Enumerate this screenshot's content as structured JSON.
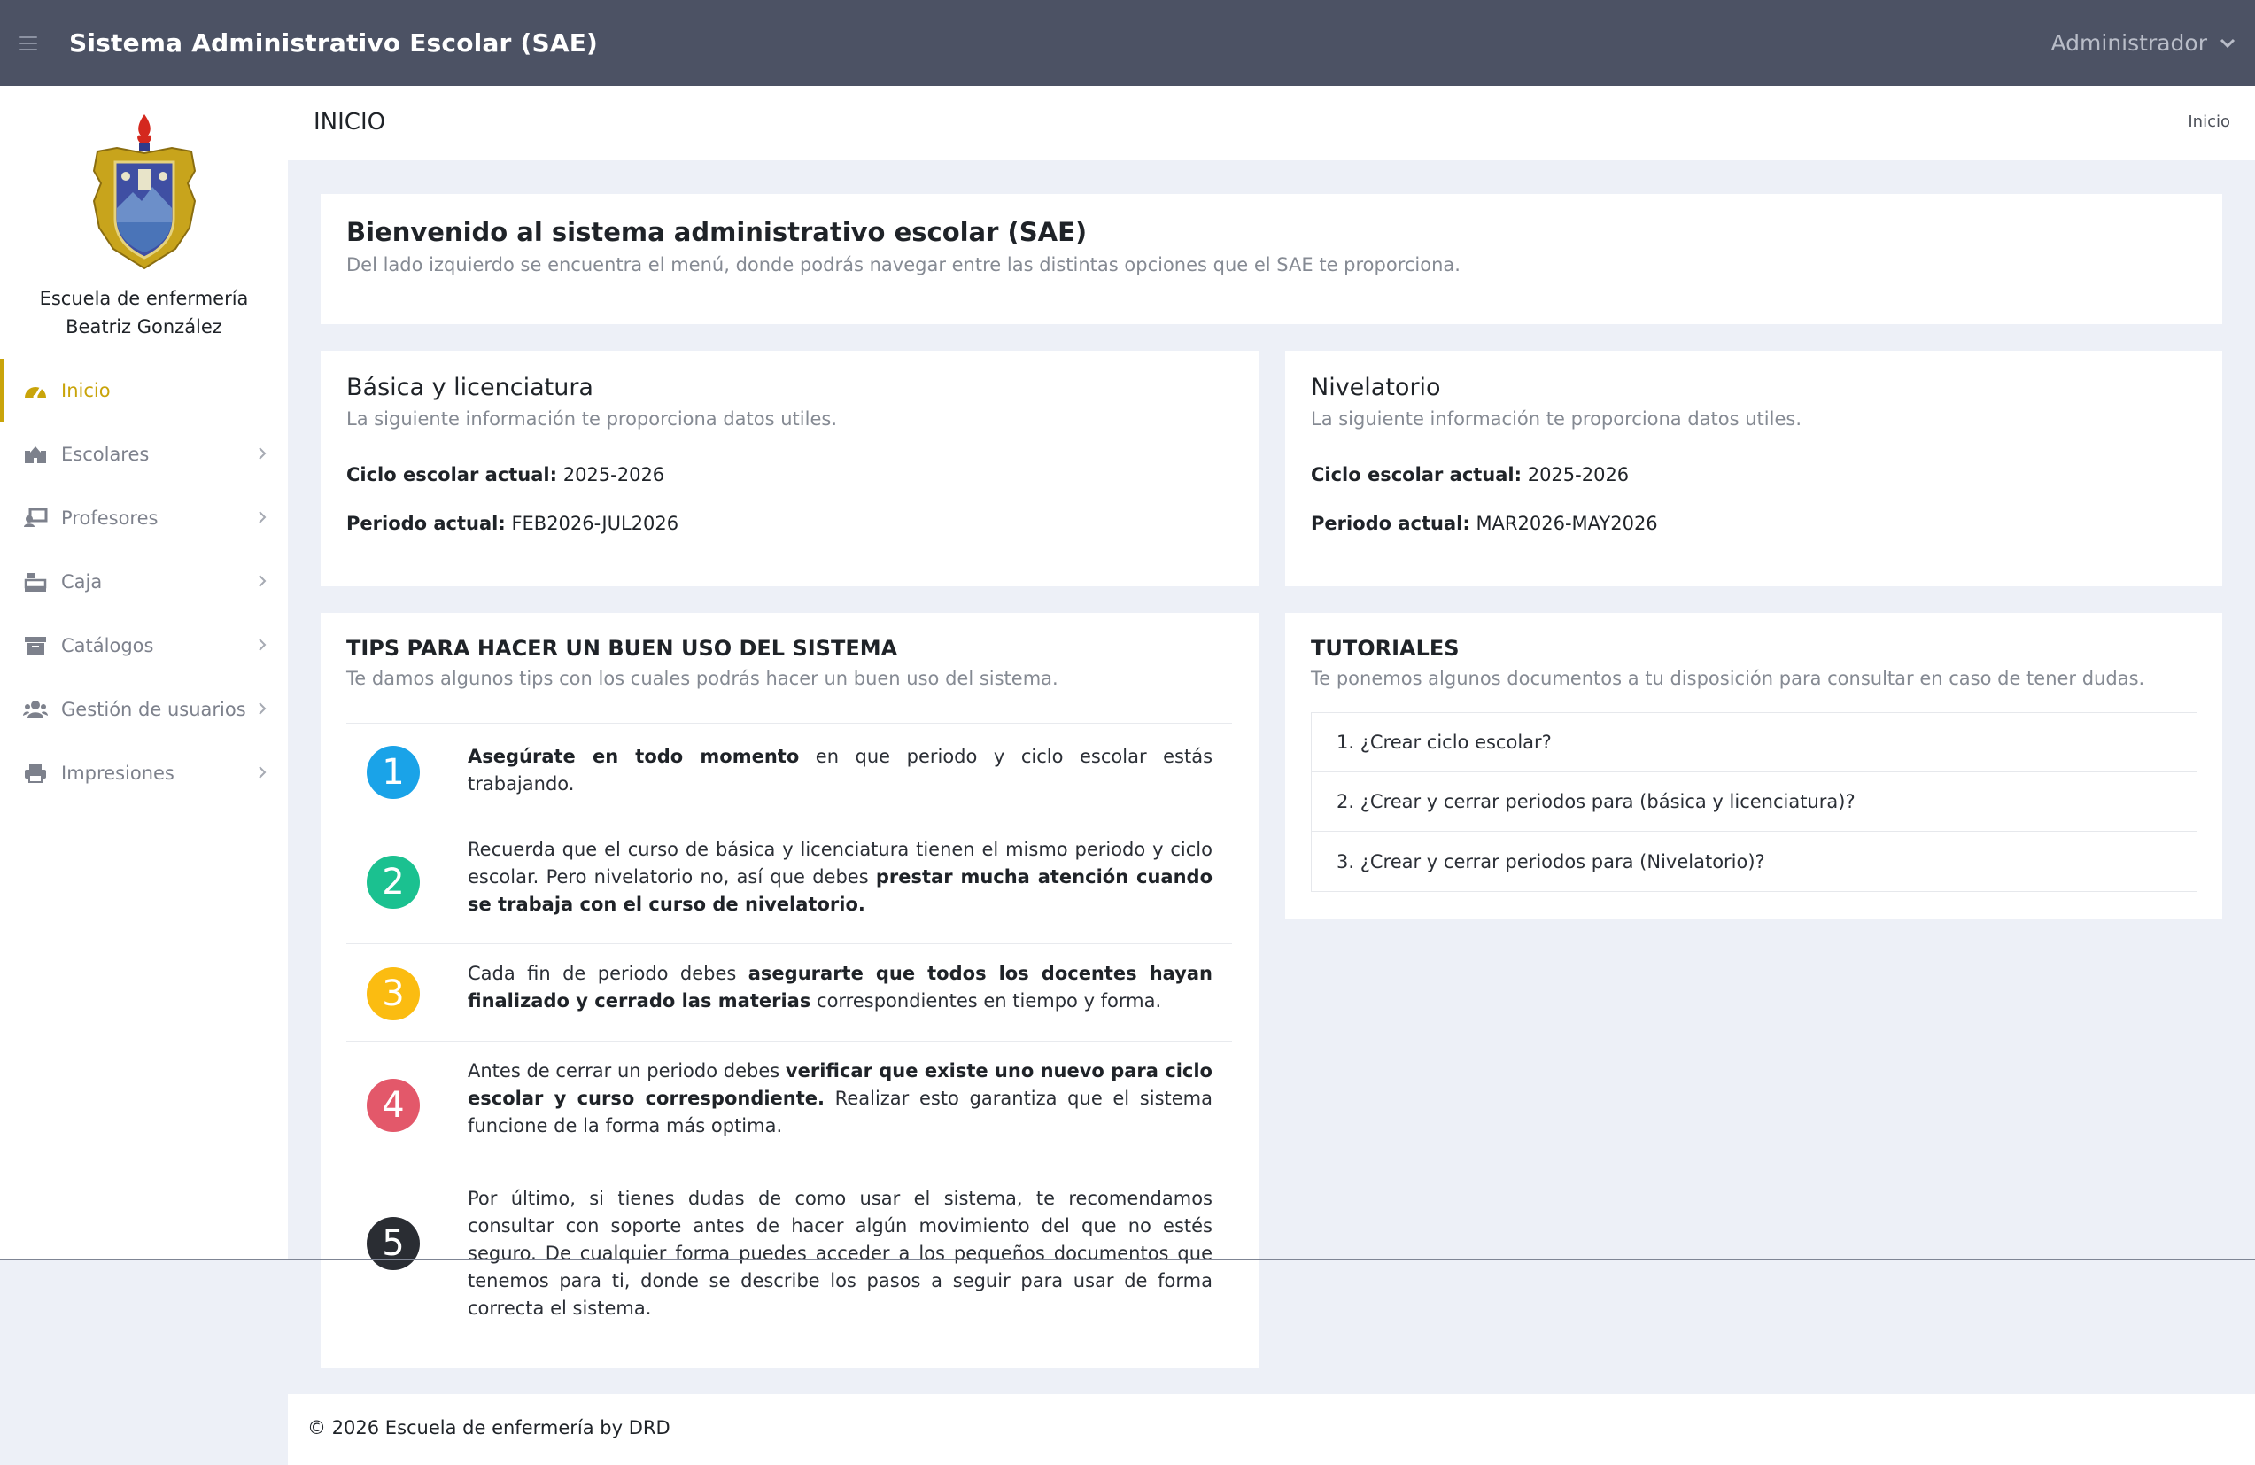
{
  "header": {
    "title": "Sistema Administrativo Escolar (SAE)",
    "user": "Administrador",
    "colors": {
      "bar": "#4c5264",
      "accent": "#c9a40a"
    }
  },
  "sidebar": {
    "school_name_line1": "Escuela de enfermería",
    "school_name_line2": "Beatriz González",
    "items": [
      {
        "label": "Inicio",
        "icon": "dashboard-icon",
        "active": true
      },
      {
        "label": "Escolares",
        "icon": "school-icon"
      },
      {
        "label": "Profesores",
        "icon": "teacher-icon"
      },
      {
        "label": "Caja",
        "icon": "cash-register-icon"
      },
      {
        "label": "Catálogos",
        "icon": "archive-icon"
      },
      {
        "label": "Gestión de usuarios",
        "icon": "users-icon"
      },
      {
        "label": "Impresiones",
        "icon": "printer-icon"
      }
    ]
  },
  "page": {
    "title": "INICIO",
    "breadcrumb": "Inicio"
  },
  "welcome": {
    "title": "Bienvenido al sistema administrativo escolar (SAE)",
    "subtitle": "Del lado izquierdo se encuentra el menú, donde podrás navegar entre las distintas opciones que el SAE te proporciona."
  },
  "basica": {
    "title": "Básica y licenciatura",
    "subtitle": "La siguiente información te proporciona datos utiles.",
    "ciclo_label": "Ciclo escolar actual:",
    "ciclo_value": " 2025-2026",
    "periodo_label": "Periodo actual:",
    "periodo_value": " FEB2026-JUL2026"
  },
  "nivelatorio": {
    "title": "Nivelatorio",
    "subtitle": "La siguiente información te proporciona datos utiles.",
    "ciclo_label": "Ciclo escolar actual:",
    "ciclo_value": " 2025-2026",
    "periodo_label": "Periodo actual:",
    "periodo_value": " MAR2026-MAY2026"
  },
  "tips": {
    "title": "TIPS PARA HACER UN BUEN USO DEL SISTEMA",
    "subtitle": "Te damos algunos tips con los cuales podrás hacer un buen uso del sistema.",
    "items": [
      {
        "num": "1",
        "color": "#1aa3e8",
        "parts": [
          {
            "b": true,
            "t": "Asegúrate en todo momento"
          },
          {
            "t": " en que periodo y ciclo escolar estás trabajando."
          }
        ]
      },
      {
        "num": "2",
        "color": "#1bc190",
        "parts": [
          {
            "t": "Recuerda que el curso de básica y licenciatura tienen el mismo periodo y ciclo escolar. Pero nivelatorio no, así que debes "
          },
          {
            "b": true,
            "t": "prestar mucha atención cuando se trabaja con el curso de nivelatorio."
          }
        ]
      },
      {
        "num": "3",
        "color": "#fbbc11",
        "parts": [
          {
            "t": "Cada fin de periodo debes "
          },
          {
            "b": true,
            "t": "asegurarte que todos los docentes hayan finalizado y cerrado las materias"
          },
          {
            "t": " correspondientes en tiempo y forma."
          }
        ]
      },
      {
        "num": "4",
        "color": "#e3586a",
        "parts": [
          {
            "t": "Antes de cerrar un periodo debes "
          },
          {
            "b": true,
            "t": "verificar que existe uno nuevo para ciclo escolar y curso correspondiente."
          },
          {
            "t": " Realizar esto garantiza que el sistema funcione de la forma más optima."
          }
        ]
      },
      {
        "num": "5",
        "color": "#2a2d33",
        "parts": [
          {
            "t": "Por último, si tienes dudas de como usar el sistema, te recomendamos consultar con soporte antes de hacer algún movimiento del que no estés seguro. De cualquier forma puedes acceder a los pequeños documentos que tenemos para ti, donde se describe los pasos a seguir para usar de forma correcta el sistema."
          }
        ]
      }
    ]
  },
  "tutorials": {
    "title": "TUTORIALES",
    "subtitle": "Te ponemos algunos documentos a tu disposición para consultar en caso de tener dudas.",
    "items": [
      "1. ¿Crear ciclo escolar?",
      "2. ¿Crear y cerrar periodos para (básica y licenciatura)?",
      "3. ¿Crear y cerrar periodos para (Nivelatorio)?"
    ]
  },
  "footer": {
    "text": "© 2026 Escuela de enfermería by DRD"
  }
}
